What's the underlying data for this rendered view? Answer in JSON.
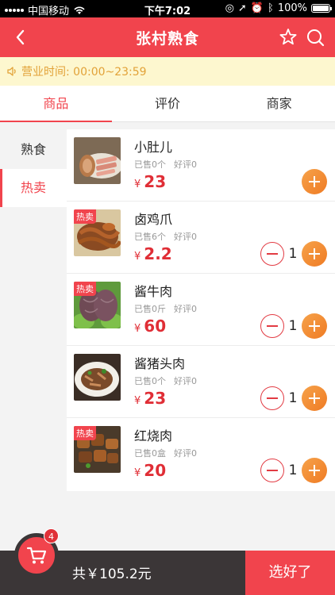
{
  "status_bar": {
    "carrier": "中国移动",
    "time": "下午7:02",
    "battery": "100%"
  },
  "nav": {
    "title": "张村熟食",
    "back_icon": "chevron-left-icon",
    "favorite_icon": "star-icon",
    "search_icon": "search-icon"
  },
  "notice": {
    "icon": "speaker-icon",
    "text": "营业时间: 00:00~23:59"
  },
  "tabs": [
    {
      "label": "商品",
      "active": true
    },
    {
      "label": "评价",
      "active": false
    },
    {
      "label": "商家",
      "active": false
    }
  ],
  "categories": [
    {
      "label": "熟食",
      "active": false
    },
    {
      "label": "热卖",
      "active": true
    }
  ],
  "products": [
    {
      "name": "小肚儿",
      "sold": "已售0个",
      "rating": "好评0",
      "currency": "¥",
      "price": "23",
      "hot": "",
      "count": ""
    },
    {
      "name": "卤鸡爪",
      "sold": "已售6个",
      "rating": "好评0",
      "currency": "¥",
      "price": "2.2",
      "hot": "热卖",
      "count": "1"
    },
    {
      "name": "酱牛肉",
      "sold": "已售0斤",
      "rating": "好评0",
      "currency": "¥",
      "price": "60",
      "hot": "热卖",
      "count": "1"
    },
    {
      "name": "酱猪头肉",
      "sold": "已售0个",
      "rating": "好评0",
      "currency": "¥",
      "price": "23",
      "hot": "",
      "count": "1"
    },
    {
      "name": "红烧肉",
      "sold": "已售0盒",
      "rating": "好评0",
      "currency": "¥",
      "price": "20",
      "hot": "热卖",
      "count": "1"
    }
  ],
  "cart": {
    "badge": "4",
    "total": "共￥105.2元",
    "checkout_label": "选好了"
  },
  "colors": {
    "primary": "#f1444d",
    "price": "#e02e36",
    "add_button": "#f08a2e",
    "notice_bg": "#fdf7cf",
    "notice_text": "#e2a238"
  }
}
